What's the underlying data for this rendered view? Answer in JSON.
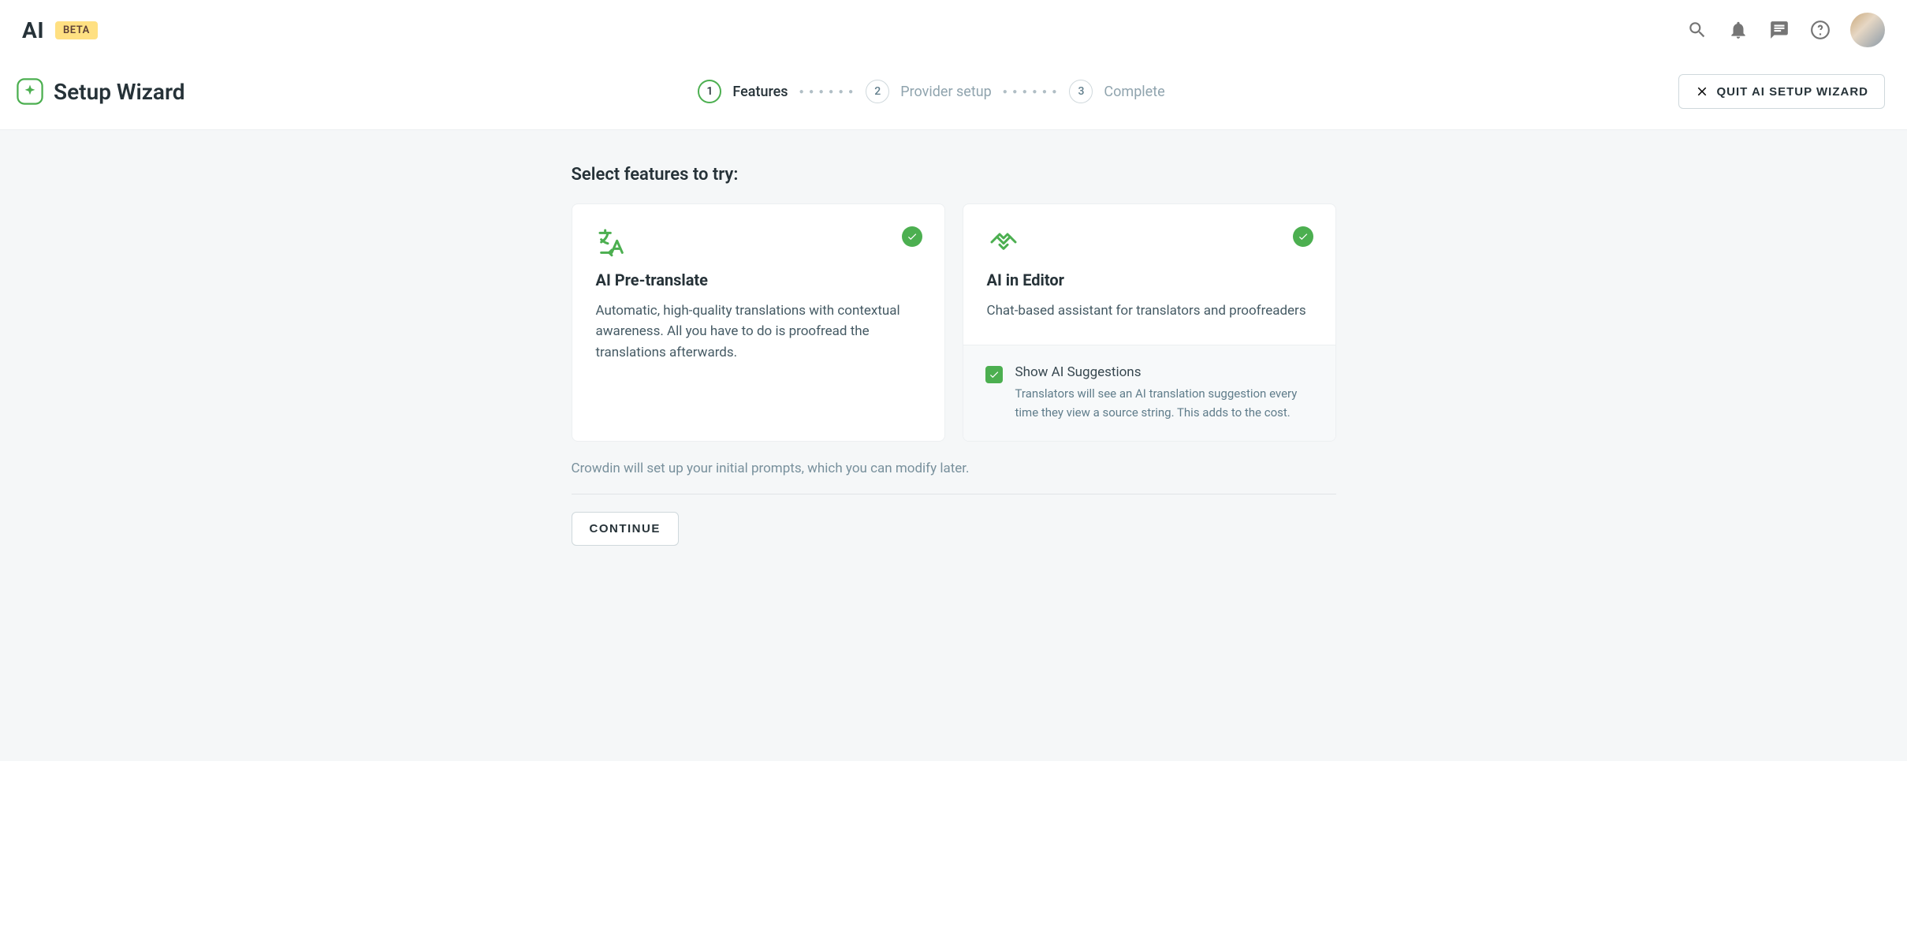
{
  "header": {
    "app_label": "AI",
    "badge": "BETA"
  },
  "wizard": {
    "title": "Setup Wizard",
    "quit_label": "QUIT AI SETUP WIZARD",
    "steps": [
      {
        "num": "1",
        "label": "Features"
      },
      {
        "num": "2",
        "label": "Provider setup"
      },
      {
        "num": "3",
        "label": "Complete"
      }
    ]
  },
  "content": {
    "heading": "Select features to try:",
    "hint": "Crowdin will set up your initial prompts, which you can modify later.",
    "continue_label": "CONTINUE",
    "cards": [
      {
        "title": "AI Pre-translate",
        "desc": "Automatic, high-quality translations with contextual awareness. All you have to do is proofread the translations afterwards."
      },
      {
        "title": "AI in Editor",
        "desc": "Chat-based assistant for translators and proofreaders",
        "sub": {
          "title": "Show AI Suggestions",
          "desc": "Translators will see an AI translation suggestion every time they view a source string. This adds to the cost."
        }
      }
    ]
  }
}
